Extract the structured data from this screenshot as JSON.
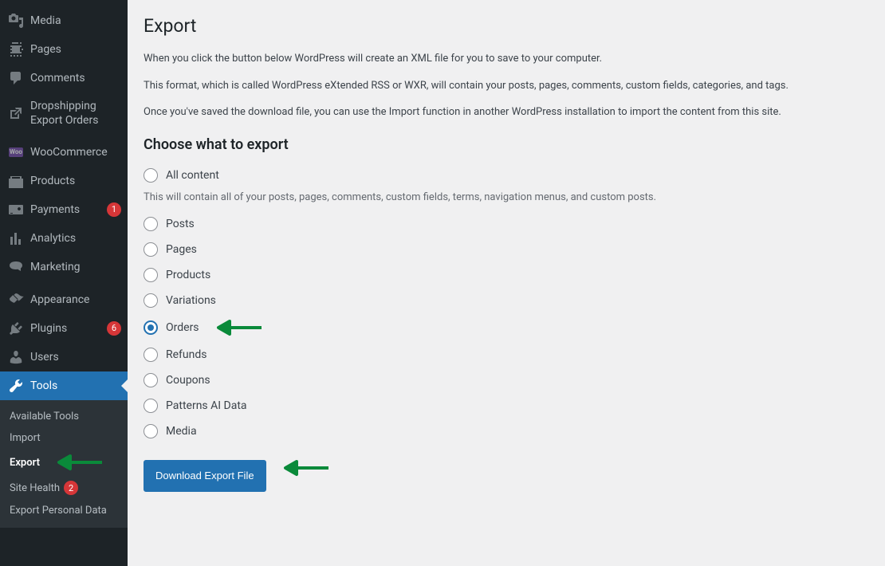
{
  "sidebar": {
    "items": [
      {
        "label": "Media",
        "icon": "media"
      },
      {
        "label": "Pages",
        "icon": "pages"
      },
      {
        "label": "Comments",
        "icon": "comments"
      },
      {
        "label": "Dropshipping Export Orders",
        "icon": "external"
      },
      {
        "label": "WooCommerce",
        "icon": "woo"
      },
      {
        "label": "Products",
        "icon": "products"
      },
      {
        "label": "Payments",
        "icon": "payments",
        "badge": "1"
      },
      {
        "label": "Analytics",
        "icon": "analytics"
      },
      {
        "label": "Marketing",
        "icon": "marketing"
      },
      {
        "label": "Appearance",
        "icon": "appearance"
      },
      {
        "label": "Plugins",
        "icon": "plugins",
        "badge": "6"
      },
      {
        "label": "Users",
        "icon": "users"
      },
      {
        "label": "Tools",
        "icon": "tools",
        "current": true
      }
    ],
    "submenu": [
      {
        "label": "Available Tools"
      },
      {
        "label": "Import"
      },
      {
        "label": "Export",
        "current": true,
        "arrow": true
      },
      {
        "label": "Site Health",
        "badge": "2"
      },
      {
        "label": "Export Personal Data"
      }
    ]
  },
  "page": {
    "title": "Export",
    "desc1": "When you click the button below WordPress will create an XML file for you to save to your computer.",
    "desc2": "This format, which is called WordPress eXtended RSS or WXR, will contain your posts, pages, comments, custom fields, categories, and tags.",
    "desc3": "Once you've saved the download file, you can use the Import function in another WordPress installation to import the content from this site.",
    "section_title": "Choose what to export",
    "all_content_hint": "This will contain all of your posts, pages, comments, custom fields, terms, navigation menus, and custom posts.",
    "options": [
      {
        "label": "All content",
        "hint": true
      },
      {
        "label": "Posts"
      },
      {
        "label": "Pages"
      },
      {
        "label": "Products"
      },
      {
        "label": "Variations"
      },
      {
        "label": "Orders",
        "checked": true,
        "arrow": true
      },
      {
        "label": "Refunds"
      },
      {
        "label": "Coupons"
      },
      {
        "label": "Patterns AI Data"
      },
      {
        "label": "Media"
      }
    ],
    "button": "Download Export File"
  }
}
